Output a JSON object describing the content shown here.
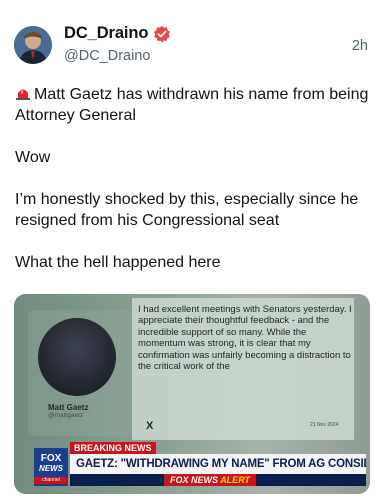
{
  "post": {
    "display_name": "DC_Draino",
    "handle": "@DC_Draino",
    "time": "2h",
    "paragraphs": [
      "Matt Gaetz has withdrawn his name from being Attorney General",
      "Wow",
      "I’m honestly shocked by this, especially since he resigned from his Congressional seat",
      "What the hell happened here"
    ]
  },
  "media": {
    "tweet_name": "Matt Gaetz",
    "tweet_handle": "@mattgaetz",
    "quote": "I had excellent meetings with Senators yesterday. I appreciate their thoughtful feedback - and the incredible support of so many. While the momentum was strong, it is clear that my confirmation was unfairly becoming a distraction to the critical work of the",
    "quote_date": "21 Nov 2024",
    "quote_x": "X",
    "breaking": "BREAKING NEWS",
    "chyron": "GAETZ: \"WITHDRAWING MY NAME\" FROM AG CONSIDERATION",
    "alert_brand": "FOX NEWS",
    "alert_word": "ALERT",
    "logo_line1": "FOX",
    "logo_line2": "NEWS",
    "logo_line3": "channel"
  },
  "colors": {
    "verified": "#e5484d",
    "fox_blue": "#1a3e8c",
    "fox_red": "#c5161d"
  },
  "icons": [
    "verified-badge-icon",
    "siren-icon"
  ]
}
